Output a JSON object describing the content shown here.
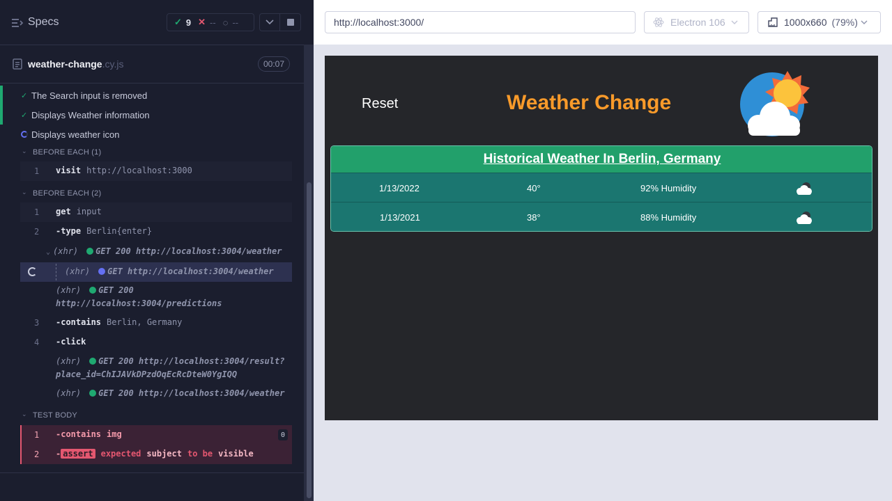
{
  "reporter": {
    "specs_label": "Specs",
    "stats": {
      "passed": "9",
      "failed": "--",
      "pending": "--"
    },
    "file": {
      "name": "weather-change",
      "ext": ".cy.js",
      "duration": "00:07"
    },
    "tests": [
      {
        "label": "The Search input is removed",
        "state": "passed"
      },
      {
        "label": "Displays Weather information",
        "state": "passed"
      },
      {
        "label": "Displays weather icon",
        "state": "running"
      }
    ],
    "hooks": {
      "before_each_1": {
        "title": "BEFORE EACH (1)",
        "commands": [
          {
            "num": "1",
            "name": "visit",
            "arg": "http://localhost:3000"
          }
        ]
      },
      "before_each_2": {
        "title": "BEFORE EACH (2)",
        "commands": [
          {
            "num": "1",
            "name": "get",
            "arg": "input"
          },
          {
            "num": "2",
            "name": "-type",
            "arg": "Berlin{enter}"
          },
          {
            "num": "3",
            "name": "-contains",
            "arg": "Berlin, Germany"
          },
          {
            "num": "4",
            "name": "-click",
            "arg": ""
          }
        ],
        "xhrs": [
          {
            "label": "(xhr)",
            "method": "GET 200",
            "url": "http://localhost:3004/weather"
          },
          {
            "label": "(xhr)",
            "method": "GET",
            "url": "http://localhost:3004/weather"
          },
          {
            "label": "(xhr)",
            "method": "GET 200",
            "url": "http://localhost:3004/predictions"
          },
          {
            "label": "(xhr)",
            "method": "GET 200",
            "url": "http://localhost:3004/result?",
            "url2": "place_id=ChIJAVkDPzdOqEcRcDteW0YgIQQ"
          },
          {
            "label": "(xhr)",
            "method": "GET 200",
            "url": "http://localhost:3004/weather"
          }
        ]
      },
      "test_body": {
        "title": "TEST BODY",
        "cmd1": {
          "num": "1",
          "name": "-contains",
          "arg": "img",
          "count": "0"
        },
        "cmd2": {
          "num": "2",
          "badge": "assert",
          "w1": "expected",
          "w2": "subject",
          "w3": "to be",
          "w4": "visible"
        }
      }
    }
  },
  "aut": {
    "url": "http://localhost:3000/",
    "browser": "Electron 106",
    "viewport": "1000x660",
    "zoom": "(79%)",
    "app": {
      "reset_label": "Reset",
      "title": "Weather Change",
      "table_title": "Historical Weather In Berlin, Germany",
      "rows": [
        {
          "date": "1/13/2022",
          "temp": "40°",
          "humidity": "92% Humidity",
          "icon": "partly-cloudy-night-icon"
        },
        {
          "date": "1/13/2021",
          "temp": "38°",
          "humidity": "88% Humidity",
          "icon": "partly-cloudy-night-icon"
        }
      ]
    }
  },
  "colors": {
    "pass": "#1fa971",
    "fail": "#e45770",
    "running": "#6470f3",
    "title_orange": "#f89a2a",
    "table_header": "#22a06b",
    "table_row": "#1b7670"
  }
}
